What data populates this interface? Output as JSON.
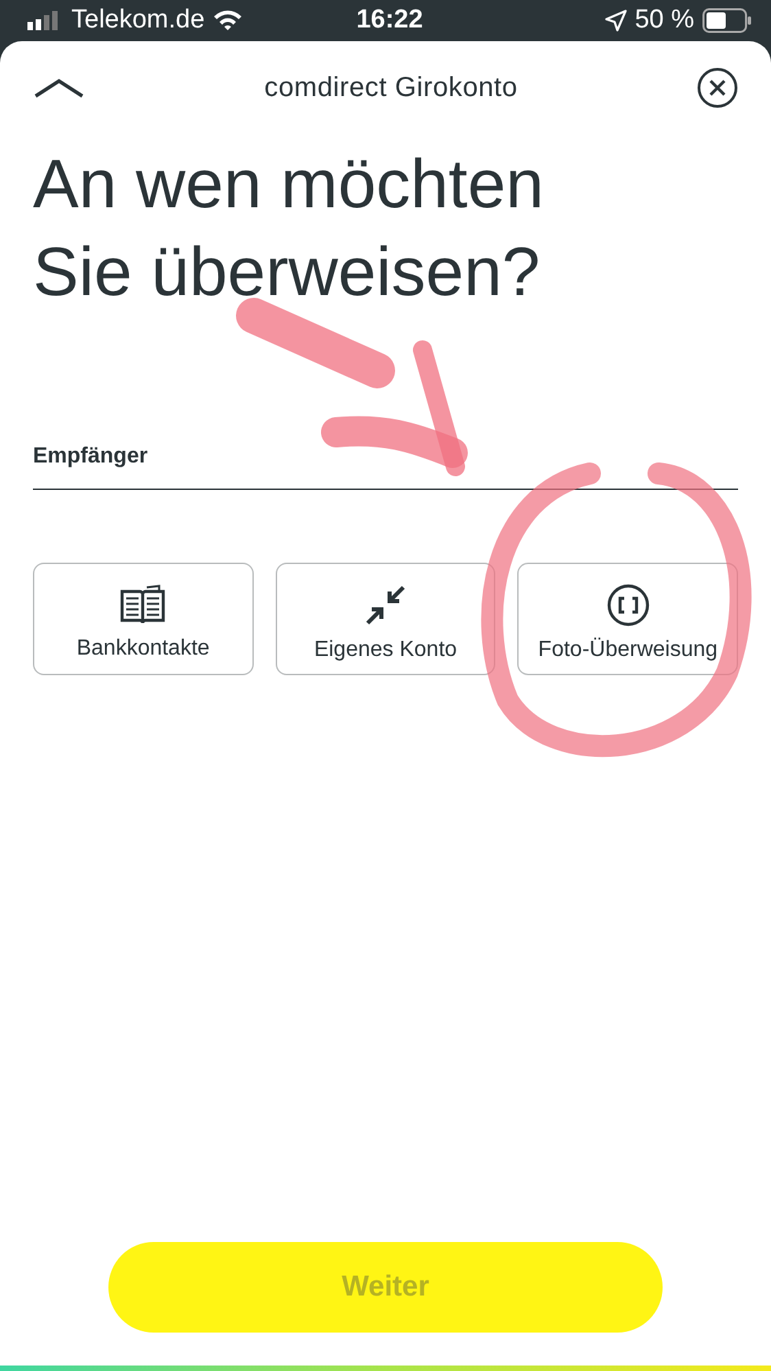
{
  "status_bar": {
    "carrier": "Telekom.de",
    "time": "16:22",
    "battery": "50 %"
  },
  "header": {
    "title": "comdirect Girokonto"
  },
  "heading": "An wen möchten Sie überweisen?",
  "recipient_field": {
    "label": "Empfänger"
  },
  "options": [
    {
      "kind": "book",
      "label": "Bankkontakte"
    },
    {
      "kind": "arrows",
      "label": "Eigenes Konto"
    },
    {
      "kind": "scan",
      "label": "Foto-Überweisung"
    }
  ],
  "continue_button": {
    "label": "Weiter",
    "disabled": true
  },
  "annotations": [
    {
      "kind": "arrow"
    },
    {
      "kind": "circle"
    }
  ]
}
